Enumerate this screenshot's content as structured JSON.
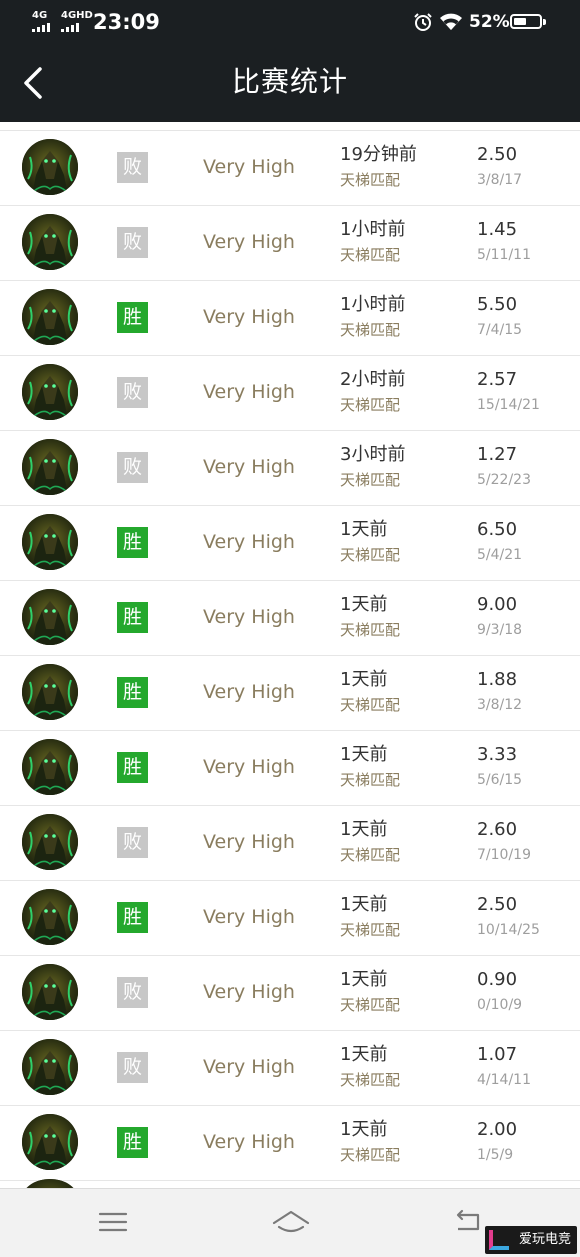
{
  "status_bar": {
    "network_1": "4G",
    "network_2": "4GHD",
    "time": "23:09",
    "battery_pct": "52%",
    "battery_level": 0.52,
    "alarm_icon": "alarm-clock-icon",
    "wifi_icon": "wifi-icon"
  },
  "header": {
    "title": "比赛统计",
    "back_icon": "chevron-left-icon"
  },
  "matches": [
    {
      "result": "败",
      "outcome": "loss",
      "skill": "Very High",
      "time": "19分钟前",
      "mode": "天梯匹配",
      "kda": "2.50",
      "kda_detail": "3/8/17"
    },
    {
      "result": "败",
      "outcome": "loss",
      "skill": "Very High",
      "time": "1小时前",
      "mode": "天梯匹配",
      "kda": "1.45",
      "kda_detail": "5/11/11"
    },
    {
      "result": "胜",
      "outcome": "win",
      "skill": "Very High",
      "time": "1小时前",
      "mode": "天梯匹配",
      "kda": "5.50",
      "kda_detail": "7/4/15"
    },
    {
      "result": "败",
      "outcome": "loss",
      "skill": "Very High",
      "time": "2小时前",
      "mode": "天梯匹配",
      "kda": "2.57",
      "kda_detail": "15/14/21"
    },
    {
      "result": "败",
      "outcome": "loss",
      "skill": "Very High",
      "time": "3小时前",
      "mode": "天梯匹配",
      "kda": "1.27",
      "kda_detail": "5/22/23"
    },
    {
      "result": "胜",
      "outcome": "win",
      "skill": "Very High",
      "time": "1天前",
      "mode": "天梯匹配",
      "kda": "6.50",
      "kda_detail": "5/4/21"
    },
    {
      "result": "胜",
      "outcome": "win",
      "skill": "Very High",
      "time": "1天前",
      "mode": "天梯匹配",
      "kda": "9.00",
      "kda_detail": "9/3/18"
    },
    {
      "result": "胜",
      "outcome": "win",
      "skill": "Very High",
      "time": "1天前",
      "mode": "天梯匹配",
      "kda": "1.88",
      "kda_detail": "3/8/12"
    },
    {
      "result": "胜",
      "outcome": "win",
      "skill": "Very High",
      "time": "1天前",
      "mode": "天梯匹配",
      "kda": "3.33",
      "kda_detail": "5/6/15"
    },
    {
      "result": "败",
      "outcome": "loss",
      "skill": "Very High",
      "time": "1天前",
      "mode": "天梯匹配",
      "kda": "2.60",
      "kda_detail": "7/10/19"
    },
    {
      "result": "胜",
      "outcome": "win",
      "skill": "Very High",
      "time": "1天前",
      "mode": "天梯匹配",
      "kda": "2.50",
      "kda_detail": "10/14/25"
    },
    {
      "result": "败",
      "outcome": "loss",
      "skill": "Very High",
      "time": "1天前",
      "mode": "天梯匹配",
      "kda": "0.90",
      "kda_detail": "0/10/9"
    },
    {
      "result": "败",
      "outcome": "loss",
      "skill": "Very High",
      "time": "1天前",
      "mode": "天梯匹配",
      "kda": "1.07",
      "kda_detail": "4/14/11"
    },
    {
      "result": "胜",
      "outcome": "win",
      "skill": "Very High",
      "time": "1天前",
      "mode": "天梯匹配",
      "kda": "2.00",
      "kda_detail": "1/5/9"
    }
  ],
  "nav_bar": {
    "menu_icon": "menu-icon",
    "home_icon": "home-icon",
    "back_icon": "back-arrow-icon"
  },
  "watermark": {
    "text": "爱玩电竞"
  },
  "colors": {
    "header_bg": "#1b1f22",
    "win": "#24a82d",
    "loss": "#c7c7c7",
    "muted_gold": "#8a7d5f"
  }
}
